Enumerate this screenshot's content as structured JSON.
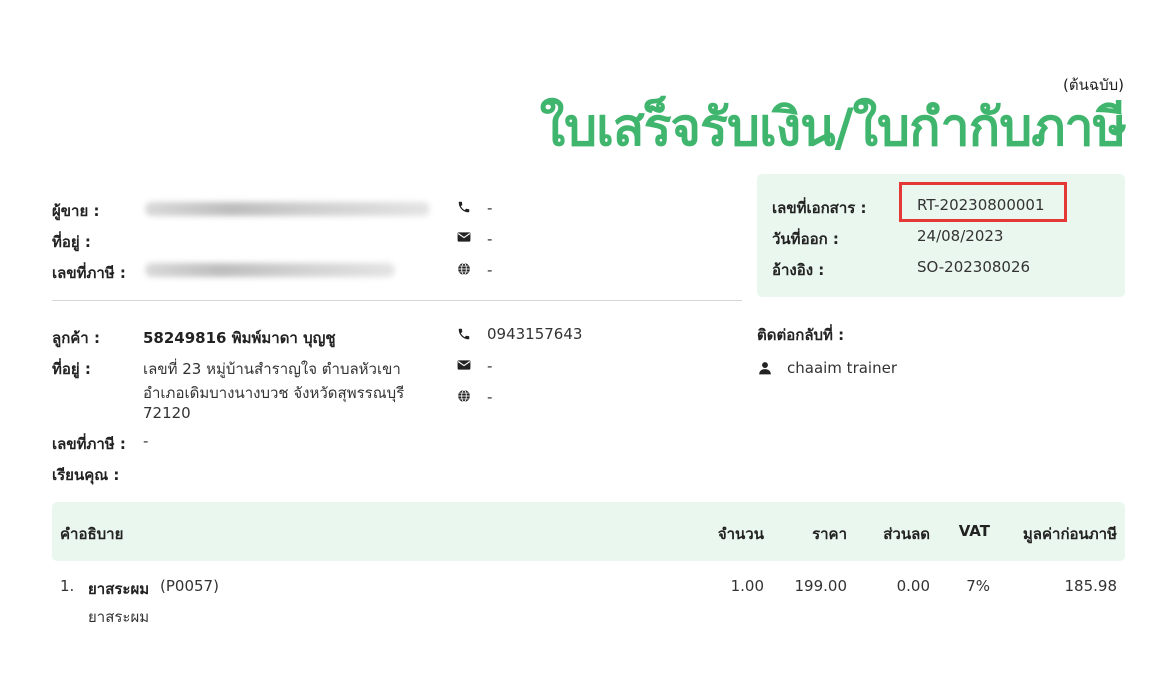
{
  "header": {
    "copy_label": "(ต้นฉบับ)",
    "title": "ใบเสร็จรับเงิน/ใบกำกับภาษี"
  },
  "seller": {
    "seller_label": "ผู้ขาย :",
    "address_label": "ที่อยู่ :",
    "tax_label": "เลขที่ภาษี :",
    "phone": "-",
    "email": "-",
    "website": "-"
  },
  "document_info": {
    "doc_no_label": "เลขที่เอกสาร :",
    "doc_no": "RT-20230800001",
    "date_label": "วันที่ออก :",
    "date": "24/08/2023",
    "ref_label": "อ้างอิง :",
    "ref": "SO-202308026"
  },
  "customer": {
    "customer_label": "ลูกค้า :",
    "customer_name": "58249816 พิมพ์มาดา บุญชู",
    "address_label": "ที่อยู่ :",
    "address_line1": "เลขที่ 23 หมู่บ้านสำราญใจ  ตำบลหัวเขา",
    "address_line2": "อำเภอเดิมบางนางบวช จังหวัดสุพรรณบุรี",
    "address_line3": "72120",
    "tax_label": "เลขที่ภาษี :",
    "tax_value": "-",
    "attn_label": "เรียนคุณ :",
    "phone": "0943157643",
    "email": "-",
    "website": "-"
  },
  "contact": {
    "label": "ติดต่อกลับที่ :",
    "name": "chaaim trainer"
  },
  "table": {
    "headers": {
      "description": "คำอธิบาย",
      "qty": "จำนวน",
      "price": "ราคา",
      "discount": "ส่วนลด",
      "vat": "VAT",
      "amount": "มูลค่าก่อนภาษี"
    },
    "rows": [
      {
        "index": "1.",
        "name": "ยาสระผม",
        "code": "(P0057)",
        "subtitle": "ยาสระผม",
        "qty": "1.00",
        "price": "199.00",
        "discount": "0.00",
        "vat": "7%",
        "amount": "185.98"
      }
    ]
  },
  "icons": [
    "phone-icon",
    "envelope-icon",
    "globe-icon",
    "user-icon"
  ],
  "colors": {
    "accent": "#3fb56d",
    "panel": "#eaf7ee",
    "highlight": "#e53935"
  }
}
